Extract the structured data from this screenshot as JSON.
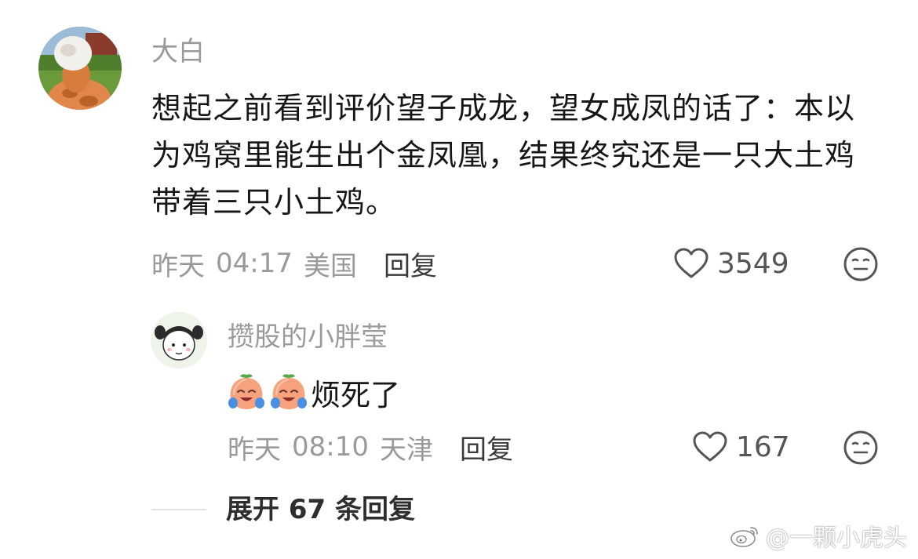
{
  "main_comment": {
    "username": "大白",
    "text": "想起之前看到评价望子成龙，望女成凤的话了：本以为鸡窝里能生出个金凤凰，结果终究还是一只大土鸡带着三只小土鸡。",
    "date": "昨天",
    "time": "04:17",
    "location": "美国",
    "reply_label": "回复",
    "like_count": "3549",
    "like_icon": "heart-outline-icon",
    "emoji_icon": "meh-face-icon"
  },
  "reply_comment": {
    "username": "攒股的小胖莹",
    "text": "烦死了",
    "emoji_icons": [
      "crying-peach-emoji",
      "crying-peach-emoji"
    ],
    "date": "昨天",
    "time": "08:10",
    "location": "天津",
    "reply_label": "回复",
    "like_count": "167",
    "like_icon": "heart-outline-icon",
    "emoji_icon": "meh-face-icon"
  },
  "expand": {
    "label": "展开 67 条回复"
  },
  "watermark": {
    "text": "@一颗小虎头",
    "icon": "weibo-logo-icon"
  },
  "colors": {
    "meta_gray": "#9a9a9a",
    "text": "#161616",
    "icon_gray": "#555555"
  }
}
